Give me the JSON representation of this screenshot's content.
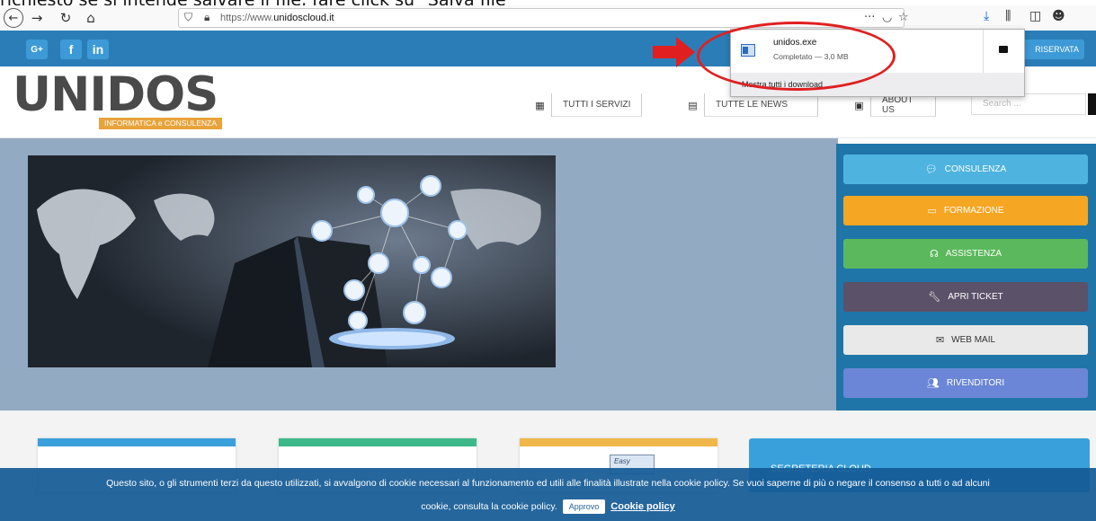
{
  "caption": "richiesto se si intende salvare il file, fare click su \"Salva file\"",
  "browser": {
    "url_prefix": "https://www.",
    "url_domain": "unidoscloud.it",
    "more_icon": "···",
    "icons": [
      "back-icon",
      "forward-icon",
      "reload-icon",
      "home-icon",
      "shield-icon",
      "lock-icon",
      "pocket-icon",
      "bookmark-star-icon",
      "downloads-icon",
      "library-icon",
      "sidebar-icon",
      "account-icon"
    ]
  },
  "site": {
    "social": [
      "G+",
      "f",
      "in"
    ],
    "reserved_label": "RISERVATA",
    "logo_text": "UNIDOS",
    "logo_sub": "INFORMATICA e CONSULENZA",
    "nav": [
      {
        "label": "TUTTI I SERVIZI",
        "icon": "grid-icon"
      },
      {
        "label": "TUTTE LE NEWS",
        "icon": "news-icon"
      },
      {
        "label": "ABOUT US",
        "icon": "idcard-icon"
      }
    ],
    "search_placeholder": "Search ..."
  },
  "sidebar": [
    {
      "label": "CONSULENZA",
      "icon": "chat-icon",
      "color": "#4fb3e0"
    },
    {
      "label": "FORMAZIONE",
      "icon": "monitor-icon",
      "color": "#f5a623"
    },
    {
      "label": "ASSISTENZA",
      "icon": "headset-icon",
      "color": "#5cb85c"
    },
    {
      "label": "APRI TICKET",
      "icon": "wrench-icon",
      "color": "#5b5168"
    },
    {
      "label": "WEB MAIL",
      "icon": "mail-icon",
      "color": "#e9e9e9"
    },
    {
      "label": "RIVENDITORI",
      "icon": "users-icon",
      "color": "#6b86d6"
    }
  ],
  "cards": {
    "bar_colors": [
      "#3aa0dc",
      "#3db88a",
      "#f0b84a"
    ],
    "easy_label": "Easy",
    "segreteria": "SEGRETERIA CLOUD"
  },
  "cookie": {
    "text": "Questo sito, o gli strumenti terzi da questo utilizzati, si avvalgono di cookie necessari al funzionamento ed utili alle finalità illustrate nella cookie policy. Se vuoi saperne di più o negare il consenso a tutti o ad alcuni",
    "text2": "cookie, consulta la cookie policy.",
    "approve": "Approvo",
    "policy": "Cookie policy"
  },
  "download": {
    "filename": "unidos.exe",
    "status": "Completato — 3,0 MB",
    "show_all": "Mostra tutti i download"
  }
}
